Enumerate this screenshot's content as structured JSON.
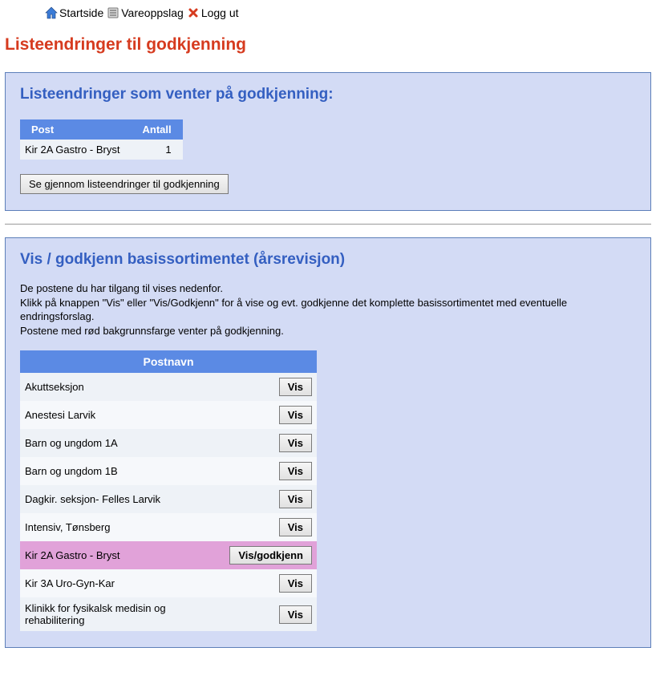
{
  "nav": {
    "startside": "Startside",
    "vareoppslag": "Vareoppslag",
    "loggut": "Logg ut"
  },
  "page_title": "Listeendringer til godkjenning",
  "pending": {
    "heading": "Listeendringer som venter på godkjenning:",
    "col_post": "Post",
    "col_antall": "Antall",
    "rows": [
      {
        "post": "Kir 2A Gastro - Bryst",
        "antall": "1"
      }
    ],
    "review_btn": "Se gjennom listeendringer til godkjenning"
  },
  "approve": {
    "heading": "Vis / godkjenn basissortimentet (årsrevisjon)",
    "desc1": "De postene du har tilgang til vises nedenfor.",
    "desc2": "Klikk på knappen \"Vis\" eller \"Vis/Godkjenn\" for å vise og evt. godkjenne det komplette basissortimentet med eventuelle endringsforslag.",
    "desc3": "Postene med rød bakgrunnsfarge venter på godkjenning.",
    "col_postnavn": "Postnavn",
    "btn_vis": "Vis",
    "btn_visgodkjenn": "Vis/godkjenn",
    "rows": [
      {
        "name": "Akuttseksjon",
        "pending": false
      },
      {
        "name": "Anestesi Larvik",
        "pending": false
      },
      {
        "name": "Barn og ungdom 1A",
        "pending": false
      },
      {
        "name": "Barn og ungdom 1B",
        "pending": false
      },
      {
        "name": "Dagkir. seksjon- Felles Larvik",
        "pending": false
      },
      {
        "name": "Intensiv, Tønsberg",
        "pending": false
      },
      {
        "name": "Kir 2A Gastro - Bryst",
        "pending": true
      },
      {
        "name": "Kir 3A Uro-Gyn-Kar",
        "pending": false
      },
      {
        "name": "Klinikk for fysikalsk medisin og rehabilitering",
        "pending": false
      }
    ]
  }
}
